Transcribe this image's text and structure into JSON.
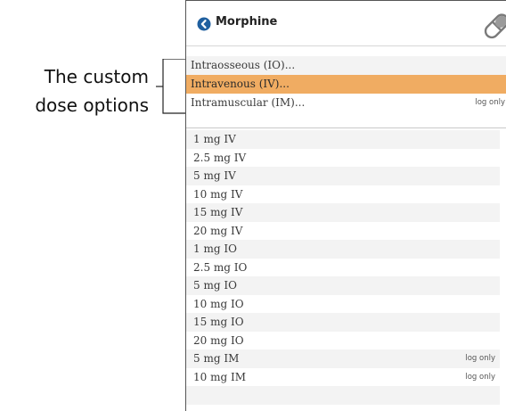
{
  "callout": {
    "line1": "The custom",
    "line2": "dose options"
  },
  "header": {
    "title": "Morphine",
    "icon": "chevron-circle-icon",
    "corner_icon": "pill-icon"
  },
  "options": [
    {
      "label": "Intraosseous (IO)...",
      "tag": ""
    },
    {
      "label": "Intravenous (IV)...",
      "tag": "",
      "selected": true
    },
    {
      "label": "Intramuscular (IM)...",
      "tag": "log only"
    }
  ],
  "presets": [
    {
      "label": "1 mg IV",
      "tag": ""
    },
    {
      "label": "2.5 mg IV",
      "tag": ""
    },
    {
      "label": "5 mg IV",
      "tag": ""
    },
    {
      "label": "10 mg IV",
      "tag": ""
    },
    {
      "label": "15 mg IV",
      "tag": ""
    },
    {
      "label": "20 mg IV",
      "tag": ""
    },
    {
      "label": "1 mg IO",
      "tag": ""
    },
    {
      "label": "2.5 mg IO",
      "tag": ""
    },
    {
      "label": "5 mg IO",
      "tag": ""
    },
    {
      "label": "10 mg IO",
      "tag": ""
    },
    {
      "label": "15 mg IO",
      "tag": ""
    },
    {
      "label": "20 mg IO",
      "tag": ""
    },
    {
      "label": "5 mg IM",
      "tag": "log only"
    },
    {
      "label": "10 mg IM",
      "tag": "log only"
    }
  ],
  "colors": {
    "selected_row": "#f0ac62",
    "header_icon": "#1f5f9f",
    "shaded_row": "#f3f3f3"
  }
}
